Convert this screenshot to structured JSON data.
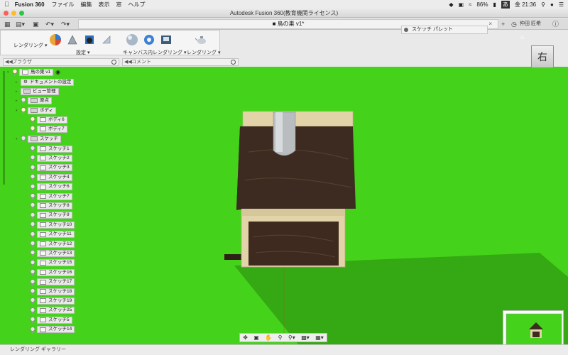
{
  "menubar": {
    "app_name": "Fusion 360",
    "items": [
      "ファイル",
      "編集",
      "表示",
      "窓",
      "ヘルプ"
    ],
    "battery": "86%",
    "ime": "あ",
    "clock": "金 21:36"
  },
  "window": {
    "title": "Autodesk Fusion 360(教育機関ライセンス)"
  },
  "tabs": {
    "document": "鳥の巣 v1*"
  },
  "user": {
    "name": "仲田 匠希"
  },
  "ribbon": {
    "workspace": "レンダリング",
    "group_setup": "設定",
    "group_canvas": "キャンバス内レンダリング",
    "group_render": "レンダリング"
  },
  "palette": {
    "title": "スケッチ パレット"
  },
  "browser": {
    "title": "ブラウザ"
  },
  "comment": {
    "title": "コメント"
  },
  "tree": {
    "root": "鳥の巣 v1",
    "doc_settings": "ドキュメントの設定",
    "view_mgmt": "ビュー管理",
    "origin": "原点",
    "bodies": "ボディ",
    "body_items": [
      "ボディ6",
      "ボディ7"
    ],
    "sketches": "スケッチ",
    "sketch_items": [
      "スケッチ1",
      "スケッチ2",
      "スケッチ3",
      "スケッチ4",
      "スケッチ6",
      "スケッチ7",
      "スケッチ8",
      "スケッチ9",
      "スケッチ10",
      "スケッチ11",
      "スケッチ12",
      "スケッチ13",
      "スケッチ15",
      "スケッチ16",
      "スケッチ17",
      "スケッチ18",
      "スケッチ19",
      "スケッチ25",
      "スケッチ5",
      "スケッチ14"
    ]
  },
  "viewcube": {
    "face": "右"
  },
  "footer": {
    "gallery": "レンダリング ギャラリー"
  },
  "colors": {
    "background": "#44d31a",
    "wood_dark": "#3d2b22",
    "wood_light": "#e2d4a8"
  }
}
